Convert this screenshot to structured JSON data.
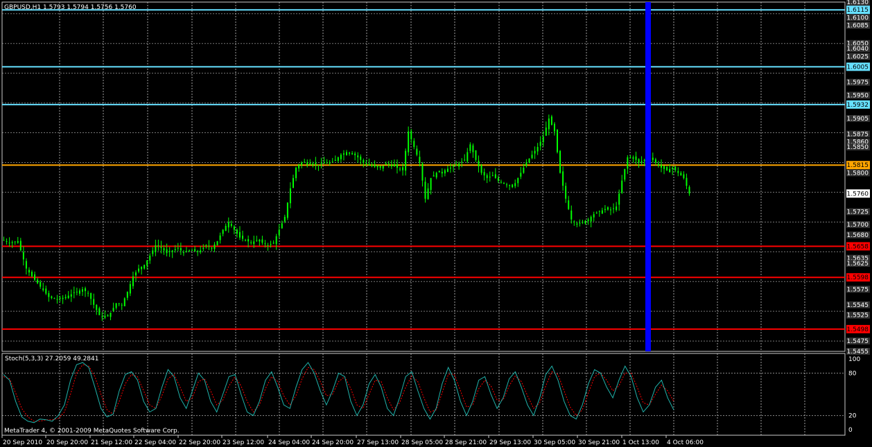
{
  "window": {
    "header": "GBPUSD,H1  1.5793 1.5794 1.5756 1.5760",
    "copyright": "MetaTrader 4, © 2001-2009 MetaQuotes Software Corp."
  },
  "colors": {
    "background": "#000000",
    "grid": "#c8c8c8",
    "candle": "#00ff00",
    "cyan_level": "#66e0ff",
    "orange_level": "#ffa500",
    "red_level": "#ff0000",
    "current_bar": "#0000ff",
    "stoch_main": "#20b2aa",
    "stoch_signal": "#ff0000"
  },
  "chart_data": [
    {
      "type": "candlestick",
      "symbol": "GBPUSD",
      "timeframe": "H1",
      "ohlc_header": "1.5793 1.5794 1.5756 1.5760",
      "ylim": [
        1.5455,
        1.613
      ],
      "grid": true,
      "price_ticks": [
        "1.6130",
        "1.6100",
        "1.6085",
        "1.6050",
        "1.6040",
        "1.6025",
        "1.5975",
        "1.5950",
        "1.5905",
        "1.5875",
        "1.5860",
        "1.5850",
        "1.5800",
        "1.5725",
        "1.5700",
        "1.5680",
        "1.5635",
        "1.5625",
        "1.5575",
        "1.5545",
        "1.5525",
        "1.5475",
        "1.5455"
      ],
      "current_price": "1.5760",
      "levels": [
        {
          "price": 1.6115,
          "label": "1.6115",
          "color": "cyan"
        },
        {
          "price": 1.6005,
          "label": "1.6005",
          "color": "cyan"
        },
        {
          "price": 1.5932,
          "label": "1.5932",
          "color": "cyan"
        },
        {
          "price": 1.5815,
          "label": "1.5815",
          "color": "orange"
        },
        {
          "price": 1.5658,
          "label": "1.5658",
          "color": "red"
        },
        {
          "price": 1.5598,
          "label": "1.5598",
          "color": "red"
        },
        {
          "price": 1.5498,
          "label": "1.5498",
          "color": "red"
        }
      ],
      "time_labels": [
        "20 Sep 2010",
        "20 Sep 20:00",
        "21 Sep 12:00",
        "22 Sep 04:00",
        "22 Sep 20:00",
        "23 Sep 12:00",
        "24 Sep 04:00",
        "24 Sep 20:00",
        "27 Sep 13:00",
        "28 Sep 05:00",
        "28 Sep 21:00",
        "29 Sep 13:00",
        "30 Sep 05:00",
        "30 Sep 21:00",
        "1 Oct 13:00",
        "4 Oct 06:00"
      ],
      "highlight_time": "1 Oct 13:00",
      "close_path": [
        [
          0,
          1.567
        ],
        [
          2,
          1.5665
        ],
        [
          5,
          1.5668
        ],
        [
          8,
          1.5615
        ],
        [
          10,
          1.56
        ],
        [
          13,
          1.558
        ],
        [
          16,
          1.556
        ],
        [
          19,
          1.5555
        ],
        [
          22,
          1.556
        ],
        [
          25,
          1.5568
        ],
        [
          28,
          1.5575
        ],
        [
          30,
          1.5568
        ],
        [
          32,
          1.5545
        ],
        [
          34,
          1.5525
        ],
        [
          36,
          1.552
        ],
        [
          38,
          1.553
        ],
        [
          40,
          1.5548
        ],
        [
          42,
          1.5545
        ],
        [
          44,
          1.557
        ],
        [
          46,
          1.56
        ],
        [
          48,
          1.5615
        ],
        [
          50,
          1.5622
        ],
        [
          52,
          1.564
        ],
        [
          54,
          1.566
        ],
        [
          56,
          1.5655
        ],
        [
          58,
          1.5645
        ],
        [
          60,
          1.565
        ],
        [
          62,
          1.5655
        ],
        [
          64,
          1.5645
        ],
        [
          66,
          1.565
        ],
        [
          68,
          1.5648
        ],
        [
          70,
          1.565
        ],
        [
          72,
          1.566
        ],
        [
          74,
          1.5655
        ],
        [
          76,
          1.5668
        ],
        [
          78,
          1.569
        ],
        [
          80,
          1.5705
        ],
        [
          82,
          1.569
        ],
        [
          84,
          1.5675
        ],
        [
          86,
          1.567
        ],
        [
          88,
          1.5665
        ],
        [
          90,
          1.567
        ],
        [
          92,
          1.5665
        ],
        [
          94,
          1.566
        ],
        [
          96,
          1.5665
        ],
        [
          98,
          1.569
        ],
        [
          100,
          1.5715
        ],
        [
          102,
          1.577
        ],
        [
          104,
          1.581
        ],
        [
          106,
          1.582
        ],
        [
          108,
          1.582
        ],
        [
          110,
          1.5818
        ],
        [
          112,
          1.5815
        ],
        [
          114,
          1.582
        ],
        [
          116,
          1.5818
        ],
        [
          118,
          1.5825
        ],
        [
          120,
          1.5835
        ],
        [
          122,
          1.584
        ],
        [
          124,
          1.5838
        ],
        [
          126,
          1.583
        ],
        [
          128,
          1.582
        ],
        [
          130,
          1.5815
        ],
        [
          132,
          1.5812
        ],
        [
          134,
          1.581
        ],
        [
          136,
          1.5818
        ],
        [
          138,
          1.5815
        ],
        [
          140,
          1.581
        ],
        [
          142,
          1.5805
        ],
        [
          144,
          1.588
        ],
        [
          146,
          1.585
        ],
        [
          148,
          1.582
        ],
        [
          150,
          1.575
        ],
        [
          152,
          1.579
        ],
        [
          154,
          1.58
        ],
        [
          156,
          1.5802
        ],
        [
          158,
          1.5808
        ],
        [
          160,
          1.5812
        ],
        [
          162,
          1.5818
        ],
        [
          164,
          1.5825
        ],
        [
          166,
          1.5855
        ],
        [
          168,
          1.5825
        ],
        [
          170,
          1.58
        ],
        [
          172,
          1.579
        ],
        [
          174,
          1.5795
        ],
        [
          176,
          1.5785
        ],
        [
          178,
          1.578
        ],
        [
          180,
          1.5775
        ],
        [
          182,
          1.578
        ],
        [
          184,
          1.58
        ],
        [
          186,
          1.582
        ],
        [
          188,
          1.5835
        ],
        [
          190,
          1.585
        ],
        [
          192,
          1.587
        ],
        [
          194,
          1.5905
        ],
        [
          196,
          1.588
        ],
        [
          198,
          1.58
        ],
        [
          200,
          1.575
        ],
        [
          202,
          1.571
        ],
        [
          204,
          1.57
        ],
        [
          206,
          1.5705
        ],
        [
          208,
          1.571
        ],
        [
          210,
          1.572
        ],
        [
          212,
          1.5725
        ],
        [
          214,
          1.573
        ],
        [
          216,
          1.5728
        ],
        [
          218,
          1.5735
        ],
        [
          220,
          1.5785
        ],
        [
          222,
          1.583
        ],
        [
          224,
          1.583
        ],
        [
          226,
          1.582
        ],
        [
          228,
          1.5825
        ],
        [
          230,
          1.583
        ],
        [
          232,
          1.582
        ],
        [
          234,
          1.581
        ],
        [
          236,
          1.5805
        ],
        [
          238,
          1.581
        ],
        [
          240,
          1.58
        ],
        [
          242,
          1.579
        ],
        [
          244,
          1.576
        ]
      ],
      "total_bars": 300
    },
    {
      "type": "line",
      "indicator": "Stoch(5,3,3)",
      "header": "Stoch(5,3,3) 27.2059 49.2841",
      "main_value": 27.2059,
      "signal_value": 49.2841,
      "ylim": [
        0,
        100
      ],
      "levels": [
        20,
        80
      ],
      "y_ticks": [
        "100",
        "80",
        "20",
        "0"
      ],
      "series": [
        {
          "name": "main",
          "values": [
            78,
            70,
            40,
            18,
            12,
            10,
            15,
            14,
            12,
            20,
            35,
            70,
            92,
            95,
            88,
            60,
            30,
            18,
            22,
            55,
            78,
            82,
            70,
            40,
            25,
            30,
            60,
            85,
            75,
            45,
            30,
            55,
            80,
            70,
            40,
            25,
            50,
            75,
            78,
            50,
            25,
            20,
            40,
            70,
            82,
            60,
            35,
            30,
            60,
            85,
            95,
            80,
            55,
            35,
            55,
            80,
            75,
            40,
            20,
            35,
            65,
            78,
            60,
            30,
            20,
            45,
            75,
            82,
            55,
            30,
            15,
            30,
            65,
            88,
            70,
            40,
            20,
            40,
            70,
            75,
            50,
            30,
            45,
            72,
            82,
            60,
            35,
            20,
            45,
            78,
            90,
            70,
            40,
            20,
            15,
            35,
            65,
            85,
            80,
            60,
            45,
            70,
            90,
            75,
            45,
            25,
            35,
            60,
            70,
            45,
            28
          ]
        },
        {
          "name": "signal",
          "values": [
            75,
            72,
            52,
            30,
            18,
            12,
            12,
            14,
            14,
            16,
            25,
            50,
            80,
            92,
            90,
            75,
            50,
            28,
            22,
            40,
            65,
            78,
            75,
            55,
            35,
            30,
            48,
            72,
            78,
            60,
            40,
            45,
            68,
            72,
            55,
            35,
            42,
            62,
            75,
            62,
            40,
            25,
            35,
            58,
            75,
            68,
            48,
            35,
            48,
            72,
            88,
            85,
            68,
            48,
            50,
            68,
            75,
            58,
            35,
            30,
            50,
            70,
            68,
            45,
            28,
            38,
            60,
            76,
            68,
            45,
            25,
            28,
            52,
            78,
            78,
            55,
            32,
            35,
            58,
            70,
            62,
            42,
            42,
            62,
            76,
            68,
            48,
            30,
            38,
            62,
            82,
            78,
            55,
            32,
            20,
            28,
            52,
            75,
            80,
            70,
            55,
            62,
            80,
            80,
            60,
            38,
            35,
            50,
            63,
            55,
            40
          ]
        }
      ]
    }
  ]
}
